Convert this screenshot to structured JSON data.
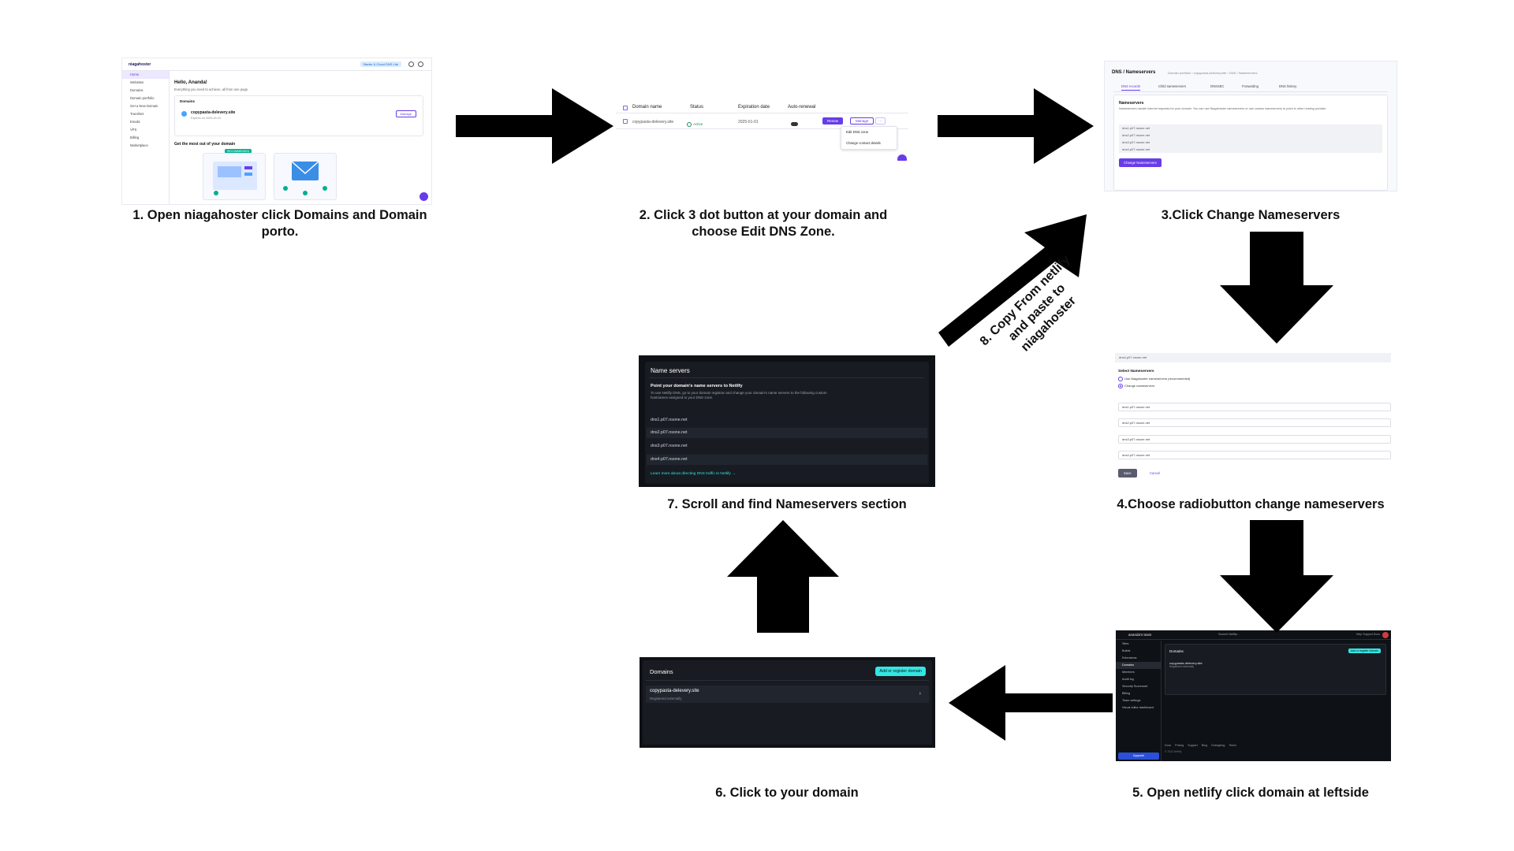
{
  "steps": {
    "s1": "1.  Open niagahoster click Domains and Domain porto.",
    "s2": "2. Click 3 dot button at your domain and choose Edit DNS Zone.",
    "s3": "3.Click Change Nameservers",
    "s4": "4.Choose radiobutton change nameservers",
    "s5": "5. Open netlify click domain at leftside",
    "s6": "6. Click to your domain",
    "s7": "7. Scroll and find Nameservers section",
    "s8": "8. Copy From netlify and paste to niagahoster"
  },
  "shot1": {
    "logo": "niagahoster",
    "plan": "Starter & Cloud DNS Lite",
    "nav": [
      "Home",
      "Websites",
      "Domains",
      "Domain portfolio",
      "Get a New Domain",
      "Transfers",
      "Emails",
      "VPS",
      "Billing",
      "Marketplace"
    ],
    "hello": "Hello, Ananda!",
    "sub": "Everything you need to achieve, all from one page.",
    "domains_head": "Domains",
    "domain": "copypasta-delevery.site",
    "expires": "Expires on 2025-01-01",
    "manage": "Manage",
    "most": "Get the most out of your domain",
    "recommended": "RECOMMENDED"
  },
  "shot2": {
    "cols": [
      "Domain name",
      "Status",
      "Expiration date",
      "Auto-renewal"
    ],
    "domain": "copypasta-delevery.site",
    "status": "Active",
    "expiry": "2025-01-01",
    "renew": "Renew",
    "manage": "Manage",
    "dots": "···",
    "menu": [
      "Edit DNS zone",
      "Change contact details"
    ]
  },
  "shot3": {
    "title": "DNS / Nameservers",
    "crumb": "Domain portfolio › copypasta-delevery.site › DNS / Nameservers",
    "tabs": [
      "DNS records",
      "Child nameservers",
      "DNSSEC",
      "Forwarding",
      "DNS history"
    ],
    "ns_head": "Nameservers",
    "ns_desc": "Nameservers handle internet requests for your domain. You can use Niagahoster nameservers or use custom nameservers to point to other hosting provider.",
    "nameservers": [
      "dns1.p07.nsone.net",
      "dns2.p07.nsone.net",
      "dns3.p07.nsone.net",
      "dns4.p07.nsone.net"
    ],
    "button": "Change Nameservers"
  },
  "shot4": {
    "top_value": "dns4.p07.nsone.net",
    "select": "Select Nameservers",
    "options": [
      "Use Niagahoster nameservers (recommended)",
      "Change nameservers"
    ],
    "inputs": [
      "dns1.p07.nsone.net",
      "dns2.p07.nsone.net",
      "dns3.p07.nsone.net",
      "dns4.p07.nsone.net"
    ],
    "save": "Save",
    "cancel": "Cancel"
  },
  "shot5": {
    "team": "ananda's team",
    "search": "Search Netlify...",
    "links": "Help   Support   Docs",
    "nav": [
      "Sites",
      "Builds",
      "Extensions",
      "Domains",
      "Members",
      "Audit log",
      "Security Scorecard",
      "Billing",
      "Team settings",
      "Visual editor dashboard"
    ],
    "upgrade": "Upgrade",
    "domains": "Domains",
    "add": "Add or register domain",
    "domain": "copypasta-delevery.site",
    "registered": "Registered externally",
    "footer": "Docs Pricing Support Blog Changelog Terms",
    "copyright": "© 2024 Netlify"
  },
  "shot6": {
    "title": "Domains",
    "add": "Add or register domain",
    "domain": "copypasta-delevery.site",
    "registered": "Registered externally",
    "chev": "›"
  },
  "shot7": {
    "title": "Name servers",
    "point": "Point your domain's name servers to Netlify",
    "desc": "To use Netlify DNS, go to your domain registrar and change your domain's name servers to the following custom hostnames assigned to your DNS zone.",
    "nameservers": [
      "dns1.p07.nsone.net",
      "dns2.p07.nsone.net",
      "dns3.p07.nsone.net",
      "dns4.p07.nsone.net"
    ],
    "learn": "Learn more about directing DNS traffic to Netlify →"
  },
  "colors": {
    "arrow": "#000000",
    "niagahoster_purple": "#673de6",
    "netlify_teal": "#32e6e2",
    "netlify_bg": "#0e1115"
  }
}
